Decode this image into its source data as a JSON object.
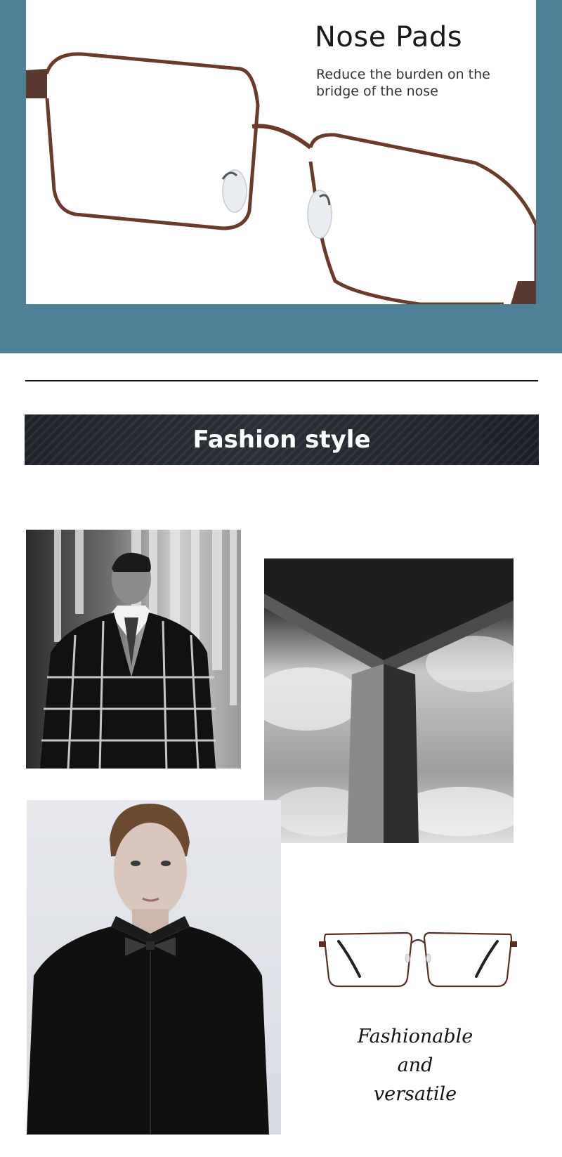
{
  "nose_pads": {
    "title": "Nose Pads",
    "subtitle": "Reduce the burden on the bridge of the nose"
  },
  "fashion": {
    "banner_title": "Fashion style",
    "tagline": [
      "Fashionable",
      "and",
      "versatile"
    ]
  },
  "colors": {
    "accent_band": "#4e8098",
    "frame_brown": "#6b3a2a",
    "banner_dark": "#22262c"
  },
  "icons": {
    "glasses": "eyeglasses-frame"
  }
}
